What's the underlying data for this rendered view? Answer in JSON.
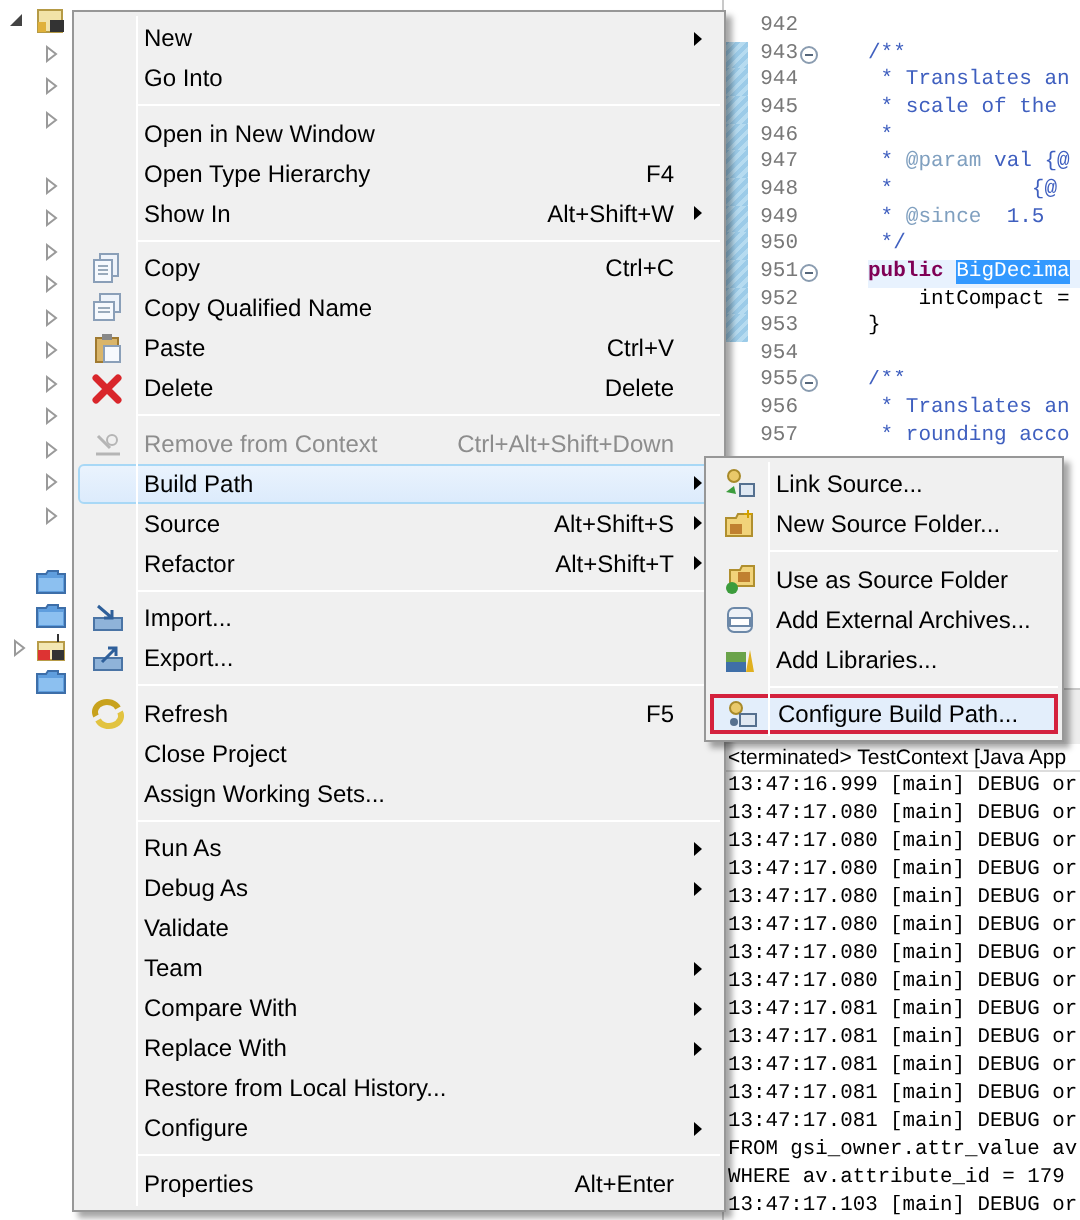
{
  "tree": {
    "rows": [
      {
        "kind": "project",
        "expanded": true
      },
      {
        "kind": "package",
        "expanded": false
      },
      {
        "kind": "package",
        "expanded": false
      },
      {
        "kind": "package",
        "expanded": false
      },
      {
        "kind": "blank"
      },
      {
        "kind": "package",
        "expanded": false
      },
      {
        "kind": "package",
        "expanded": false
      },
      {
        "kind": "package",
        "expanded": false
      },
      {
        "kind": "package",
        "expanded": false
      },
      {
        "kind": "package",
        "expanded": false
      },
      {
        "kind": "package",
        "expanded": false
      },
      {
        "kind": "package",
        "expanded": false
      },
      {
        "kind": "package",
        "expanded": false
      },
      {
        "kind": "package",
        "expanded": false
      },
      {
        "kind": "package",
        "expanded": false
      },
      {
        "kind": "package",
        "expanded": false
      },
      {
        "kind": "blank"
      },
      {
        "kind": "folder"
      },
      {
        "kind": "folder"
      },
      {
        "kind": "library",
        "expanded": false
      },
      {
        "kind": "folder"
      }
    ]
  },
  "editor": {
    "lines": [
      {
        "number": "942",
        "changed": false,
        "fold": false,
        "current": false
      },
      {
        "number": "943",
        "changed": true,
        "fold": true,
        "current": false,
        "segments": [
          {
            "kind": "comment",
            "text": "/**"
          }
        ]
      },
      {
        "number": "944",
        "changed": true,
        "fold": false,
        "current": false,
        "segments": [
          {
            "kind": "comment",
            "text": " * Translates an"
          }
        ]
      },
      {
        "number": "945",
        "changed": true,
        "fold": false,
        "current": false,
        "segments": [
          {
            "kind": "comment",
            "text": " * scale of the"
          }
        ]
      },
      {
        "number": "946",
        "changed": true,
        "fold": false,
        "current": false,
        "segments": [
          {
            "kind": "comment",
            "text": " *"
          }
        ]
      },
      {
        "number": "947",
        "changed": true,
        "fold": false,
        "current": false,
        "segments": [
          {
            "kind": "comment",
            "text": " * "
          },
          {
            "kind": "tag",
            "text": "@param"
          },
          {
            "kind": "comment",
            "text": " val {@"
          }
        ]
      },
      {
        "number": "948",
        "changed": true,
        "fold": false,
        "current": false,
        "segments": [
          {
            "kind": "comment",
            "text": " *           {@"
          }
        ]
      },
      {
        "number": "949",
        "changed": true,
        "fold": false,
        "current": false,
        "segments": [
          {
            "kind": "comment",
            "text": " * "
          },
          {
            "kind": "tag",
            "text": "@since"
          },
          {
            "kind": "comment",
            "text": "  1.5"
          }
        ]
      },
      {
        "number": "950",
        "changed": true,
        "fold": false,
        "current": false,
        "segments": [
          {
            "kind": "comment",
            "text": " */"
          }
        ]
      },
      {
        "number": "951",
        "changed": true,
        "fold": true,
        "current": true,
        "segments": [
          {
            "kind": "keyword",
            "text": "public "
          },
          {
            "kind": "selection",
            "text": "BigDecima"
          }
        ]
      },
      {
        "number": "952",
        "changed": true,
        "fold": false,
        "current": false,
        "segments": [
          {
            "kind": "plain",
            "text": "    intCompact ="
          }
        ]
      },
      {
        "number": "953",
        "changed": true,
        "fold": false,
        "current": false,
        "segments": [
          {
            "kind": "plain",
            "text": "}"
          }
        ]
      },
      {
        "number": "954",
        "changed": false,
        "fold": false,
        "current": false
      },
      {
        "number": "955",
        "changed": false,
        "fold": true,
        "current": false,
        "segments": [
          {
            "kind": "comment",
            "text": "/**"
          }
        ]
      },
      {
        "number": "956",
        "changed": false,
        "fold": false,
        "current": false,
        "segments": [
          {
            "kind": "comment",
            "text": " * Translates an"
          }
        ]
      },
      {
        "number": "957",
        "changed": false,
        "fold": false,
        "current": false,
        "segments": [
          {
            "kind": "comment",
            "text": " * rounding acco"
          }
        ]
      }
    ]
  },
  "console": {
    "title": "<terminated> TestContext [Java App",
    "lines": [
      "13:47:16.999 [main] DEBUG or",
      "13:47:17.080 [main] DEBUG or",
      "13:47:17.080 [main] DEBUG or",
      "13:47:17.080 [main] DEBUG or",
      "13:47:17.080 [main] DEBUG or",
      "13:47:17.080 [main] DEBUG or",
      "13:47:17.080 [main] DEBUG or",
      "13:47:17.080 [main] DEBUG or",
      "13:47:17.081 [main] DEBUG or",
      "13:47:17.081 [main] DEBUG or",
      "13:47:17.081 [main] DEBUG or",
      "13:47:17.081 [main] DEBUG or",
      "13:47:17.081 [main] DEBUG or",
      "FROM gsi_owner.attr_value av",
      "WHERE av.attribute_id = 179",
      "13:47:17.103 [main] DEBUG or"
    ]
  },
  "context_menu": {
    "items": [
      {
        "kind": "item",
        "label": "New",
        "submenu": true,
        "disabled": false,
        "selected": false
      },
      {
        "kind": "item",
        "label": "Go Into",
        "submenu": false,
        "disabled": false,
        "selected": false
      },
      {
        "kind": "separator"
      },
      {
        "kind": "item",
        "label": "Open in New Window",
        "submenu": false,
        "disabled": false,
        "selected": false
      },
      {
        "kind": "item",
        "label": "Open Type Hierarchy",
        "shortcut": "F4",
        "submenu": false,
        "disabled": false,
        "selected": false
      },
      {
        "kind": "item",
        "label": "Show In",
        "shortcut": "Alt+Shift+W",
        "submenu": true,
        "disabled": false,
        "selected": false
      },
      {
        "kind": "separator"
      },
      {
        "kind": "item",
        "label": "Copy",
        "shortcut": "Ctrl+C",
        "submenu": false,
        "disabled": false,
        "selected": false
      },
      {
        "kind": "item",
        "label": "Copy Qualified Name",
        "submenu": false,
        "disabled": false,
        "selected": false
      },
      {
        "kind": "item",
        "label": "Paste",
        "shortcut": "Ctrl+V",
        "submenu": false,
        "disabled": false,
        "selected": false
      },
      {
        "kind": "item",
        "label": "Delete",
        "shortcut": "Delete",
        "submenu": false,
        "disabled": false,
        "selected": false
      },
      {
        "kind": "separator"
      },
      {
        "kind": "item",
        "label": "Remove from Context",
        "shortcut": "Ctrl+Alt+Shift+Down",
        "submenu": false,
        "disabled": true,
        "selected": false
      },
      {
        "kind": "item",
        "label": "Build Path",
        "submenu": true,
        "disabled": false,
        "selected": true
      },
      {
        "kind": "item",
        "label": "Source",
        "shortcut": "Alt+Shift+S",
        "submenu": true,
        "disabled": false,
        "selected": false
      },
      {
        "kind": "item",
        "label": "Refactor",
        "shortcut": "Alt+Shift+T",
        "submenu": true,
        "disabled": false,
        "selected": false
      },
      {
        "kind": "separator"
      },
      {
        "kind": "item",
        "label": "Import...",
        "submenu": false,
        "disabled": false,
        "selected": false
      },
      {
        "kind": "item",
        "label": "Export...",
        "submenu": false,
        "disabled": false,
        "selected": false
      },
      {
        "kind": "separator"
      },
      {
        "kind": "item",
        "label": "Refresh",
        "shortcut": "F5",
        "submenu": false,
        "disabled": false,
        "selected": false
      },
      {
        "kind": "item",
        "label": "Close Project",
        "submenu": false,
        "disabled": false,
        "selected": false
      },
      {
        "kind": "item",
        "label": "Assign Working Sets...",
        "submenu": false,
        "disabled": false,
        "selected": false
      },
      {
        "kind": "separator"
      },
      {
        "kind": "item",
        "label": "Run As",
        "submenu": true,
        "disabled": false,
        "selected": false
      },
      {
        "kind": "item",
        "label": "Debug As",
        "submenu": true,
        "disabled": false,
        "selected": false
      },
      {
        "kind": "item",
        "label": "Validate",
        "submenu": false,
        "disabled": false,
        "selected": false
      },
      {
        "kind": "item",
        "label": "Team",
        "submenu": true,
        "disabled": false,
        "selected": false
      },
      {
        "kind": "item",
        "label": "Compare With",
        "submenu": true,
        "disabled": false,
        "selected": false
      },
      {
        "kind": "item",
        "label": "Replace With",
        "submenu": true,
        "disabled": false,
        "selected": false
      },
      {
        "kind": "item",
        "label": "Restore from Local History...",
        "submenu": false,
        "disabled": false,
        "selected": false
      },
      {
        "kind": "item",
        "label": "Configure",
        "submenu": true,
        "disabled": false,
        "selected": false
      },
      {
        "kind": "separator"
      },
      {
        "kind": "item",
        "label": "Properties",
        "shortcut": "Alt+Enter",
        "submenu": false,
        "disabled": false,
        "selected": false
      }
    ]
  },
  "build_path_submenu": {
    "items": [
      {
        "kind": "item",
        "label": "Link Source...",
        "selected": false
      },
      {
        "kind": "item",
        "label": "New Source Folder...",
        "selected": false
      },
      {
        "kind": "separator"
      },
      {
        "kind": "item",
        "label": "Use as Source Folder",
        "selected": false
      },
      {
        "kind": "item",
        "label": "Add External Archives...",
        "selected": false
      },
      {
        "kind": "item",
        "label": "Add Libraries...",
        "selected": false
      },
      {
        "kind": "separator"
      },
      {
        "kind": "item",
        "label": "Configure Build Path...",
        "selected": true
      }
    ]
  }
}
